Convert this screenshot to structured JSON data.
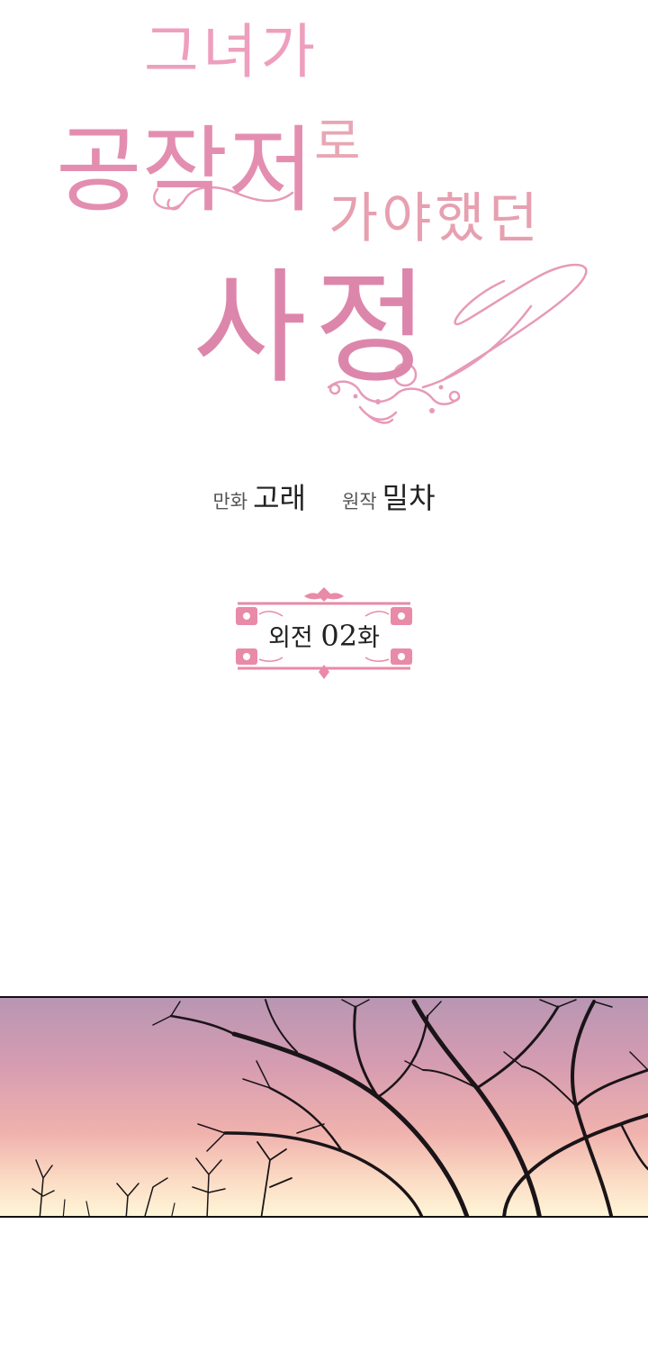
{
  "title": {
    "line1": "그녀가",
    "line2_main": "공작저",
    "line2_small": "로",
    "line3": "가야했던",
    "line4": "사정"
  },
  "credits": {
    "art_label": "만화",
    "art_name": "고래",
    "story_label": "원작",
    "story_name": "밀차"
  },
  "episode": {
    "prefix": "외전",
    "number": "02",
    "suffix": "화"
  },
  "colors": {
    "title_pink": "#e38eb0",
    "frame_pink": "#e98aa8",
    "sky_top": "#b896b3",
    "sky_bottom": "#fff6d8",
    "branches": "#1a1418"
  }
}
